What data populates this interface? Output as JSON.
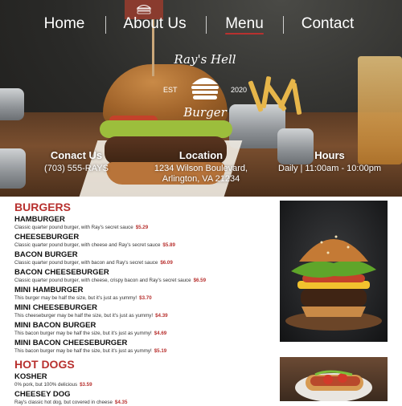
{
  "nav": {
    "items": [
      {
        "label": "Home"
      },
      {
        "label": "About Us"
      },
      {
        "label": "Menu"
      },
      {
        "label": "Contact"
      }
    ],
    "active": "Menu",
    "underline_color": "#b8312f"
  },
  "logo": {
    "name": "Ray's Hell",
    "est_label": "EST",
    "year": "2020",
    "tagline": "Burger"
  },
  "info": {
    "contact_heading": "Conact Us",
    "phone": "(703) 555-RAYS",
    "location_heading": "Location",
    "address_line1": "1234 Wilson Boulevard,",
    "address_line2": "Arlington, VA 21234",
    "hours_heading": "Hours",
    "hours": "Daily | 11:00am - 10:00pm"
  },
  "sections": {
    "burgers": {
      "title": "BURGERS",
      "items": [
        {
          "name": "HAMBURGER",
          "desc": "Classic quarter pound burger, with Ray's secret sauce",
          "price": "$5.29"
        },
        {
          "name": "CHEESEBURGER",
          "desc": "Classic quarter pound burger, with cheese and Ray's secret sauce",
          "price": "$5.89"
        },
        {
          "name": "BACON BURGER",
          "desc": "Classic quarter pound burger, with bacon and Ray's secret sauce",
          "price": "$6.09"
        },
        {
          "name": "BACON CHEESEBURGER",
          "desc": "Classic quarter pound burger, with cheese, crispy bacon and Ray's secret sauce",
          "price": "$6.59"
        },
        {
          "name": "MINI HAMBURGER",
          "desc": "This burger may be half the size, but it's just as yummy!",
          "price": "$3.70"
        },
        {
          "name": "MINI CHEESEBURGER",
          "desc": "This cheeseburger may be half the size, but it's just as yummy!",
          "price": "$4.39"
        },
        {
          "name": "MINI BACON BURGER",
          "desc": "This bacon burger may be half the size, but it's just as yummy!",
          "price": "$4.69"
        },
        {
          "name": "MINI BACON CHEESEBURGER",
          "desc": "This bacon burger may be half the size, but it's just as yummy!",
          "price": "$5.19"
        }
      ]
    },
    "hotdogs": {
      "title": "HOT DOGS",
      "items": [
        {
          "name": "KOSHER",
          "desc": "0% pork, but 100% delicious",
          "price": "$3.59"
        },
        {
          "name": "CHEESEY DOG",
          "desc": "Ray's classic hot dog, but covered in cheese",
          "price": "$4.35"
        }
      ]
    }
  },
  "colors": {
    "accent": "#b8312f",
    "text": "#111111"
  }
}
